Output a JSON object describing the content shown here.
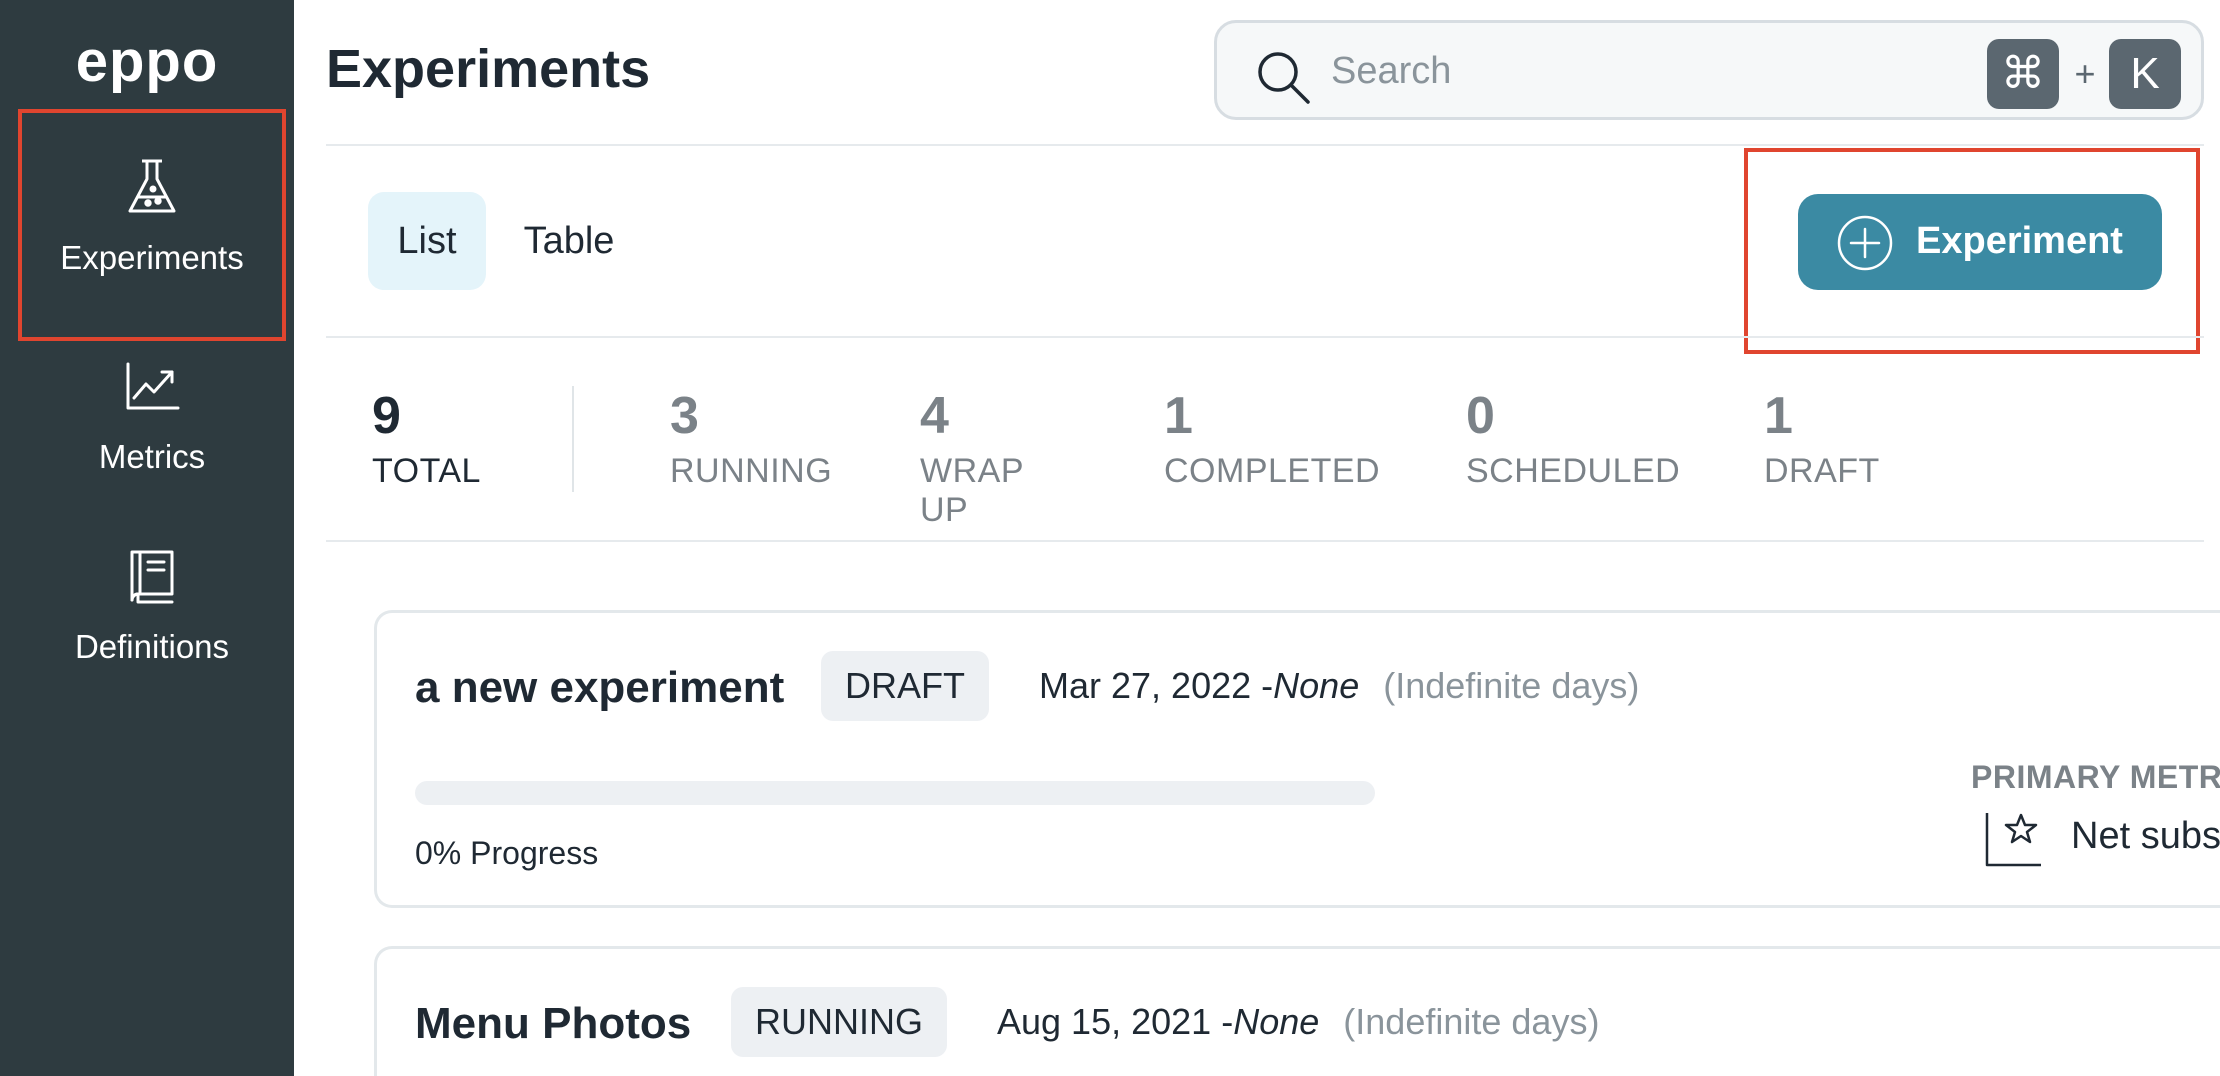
{
  "sidebar": {
    "logo": "eppo",
    "items": [
      {
        "label": "Experiments",
        "icon": "flask-icon"
      },
      {
        "label": "Metrics",
        "icon": "chart-trend-icon"
      },
      {
        "label": "Definitions",
        "icon": "book-icon"
      }
    ]
  },
  "header": {
    "title": "Experiments",
    "search": {
      "placeholder": "Search",
      "shortcut_mod": "⌘",
      "shortcut_plus": "+",
      "shortcut_key": "K"
    }
  },
  "toolbar": {
    "views": [
      "List",
      "Table"
    ],
    "active_view": "List",
    "new_button_label": "Experiment"
  },
  "stats": [
    {
      "count": "9",
      "label": "TOTAL"
    },
    {
      "count": "3",
      "label": "RUNNING"
    },
    {
      "count": "4",
      "label": "WRAP UP"
    },
    {
      "count": "1",
      "label": "COMPLETED"
    },
    {
      "count": "0",
      "label": "SCHEDULED"
    },
    {
      "count": "1",
      "label": "DRAFT"
    }
  ],
  "experiments": [
    {
      "name": "a new experiment",
      "status": "DRAFT",
      "start": "Mar 27, 2022",
      "separator": "-",
      "end": "None",
      "duration": "(Indefinite days)",
      "progress_pct": 0,
      "progress_label": "0% Progress",
      "primary_metric_label": "PRIMARY METRIC",
      "primary_metric_name": "Net subscriptions",
      "metric_icon": "star-chart-icon"
    },
    {
      "name": "Menu Photos",
      "status": "RUNNING",
      "start": "Aug 15, 2021",
      "separator": "-",
      "end": "None",
      "duration": "(Indefinite days)"
    }
  ],
  "colors": {
    "sidebar_bg": "#2e3b40",
    "accent": "#3b8aa3",
    "highlight_outline": "#e0452f",
    "active_view_bg": "#e4f4fa"
  }
}
